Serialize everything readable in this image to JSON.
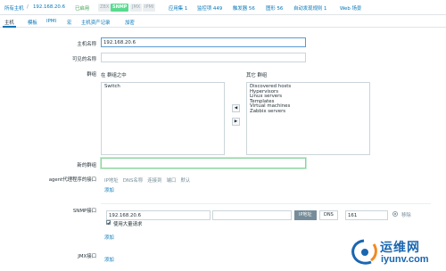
{
  "breadcrumb": {
    "all_hosts": "所有主机",
    "host_name": "192.168.20.6",
    "status": "已启用",
    "badges": [
      "ZBX",
      "SNMP",
      "JMX",
      "IPMI"
    ],
    "links": [
      "应用集 1",
      "监控项 449",
      "触发器 56",
      "图形 56",
      "自动发现规则 1",
      "Web 场景"
    ]
  },
  "tabs": [
    "主机",
    "模板",
    "IPMI",
    "宏",
    "主机资产记录",
    "加密"
  ],
  "form": {
    "host_name_label": "主机名称",
    "host_name_value": "192.168.20.6",
    "visible_name_label": "可见的名称",
    "visible_name_value": "",
    "groups_label": "群组",
    "in_groups_label": "在 群组之中",
    "other_groups_label": "其它 群组",
    "in_groups": [
      "Switch"
    ],
    "other_groups": [
      "Discovered hosts",
      "Hypervisors",
      "Linux servers",
      "Templates",
      "Virtual machines",
      "Zabbix servers"
    ],
    "move_left": "◀",
    "move_right": "▶",
    "new_group_label": "新的群组",
    "new_group_value": "",
    "agent_label": "agent代理程序的接口",
    "agent_columns": "IP地址   DNS名称   连接到   端口   默认",
    "add": "添加",
    "snmp_label": "SNMP接口",
    "snmp_ip": "192.168.20.6",
    "snmp_dns": "",
    "snmp_ip_btn": "IP地址",
    "snmp_dns_btn": "DNS",
    "snmp_port": "161",
    "remove": "移除",
    "bulk_label": "使用大量请求",
    "jmx_label": "JMX接口"
  },
  "watermark": {
    "title": "运维网",
    "url": "iyunv.com"
  },
  "colors": {
    "link": "#0275b8",
    "enabled": "#59db8f",
    "watermark": "#1a66b0"
  }
}
